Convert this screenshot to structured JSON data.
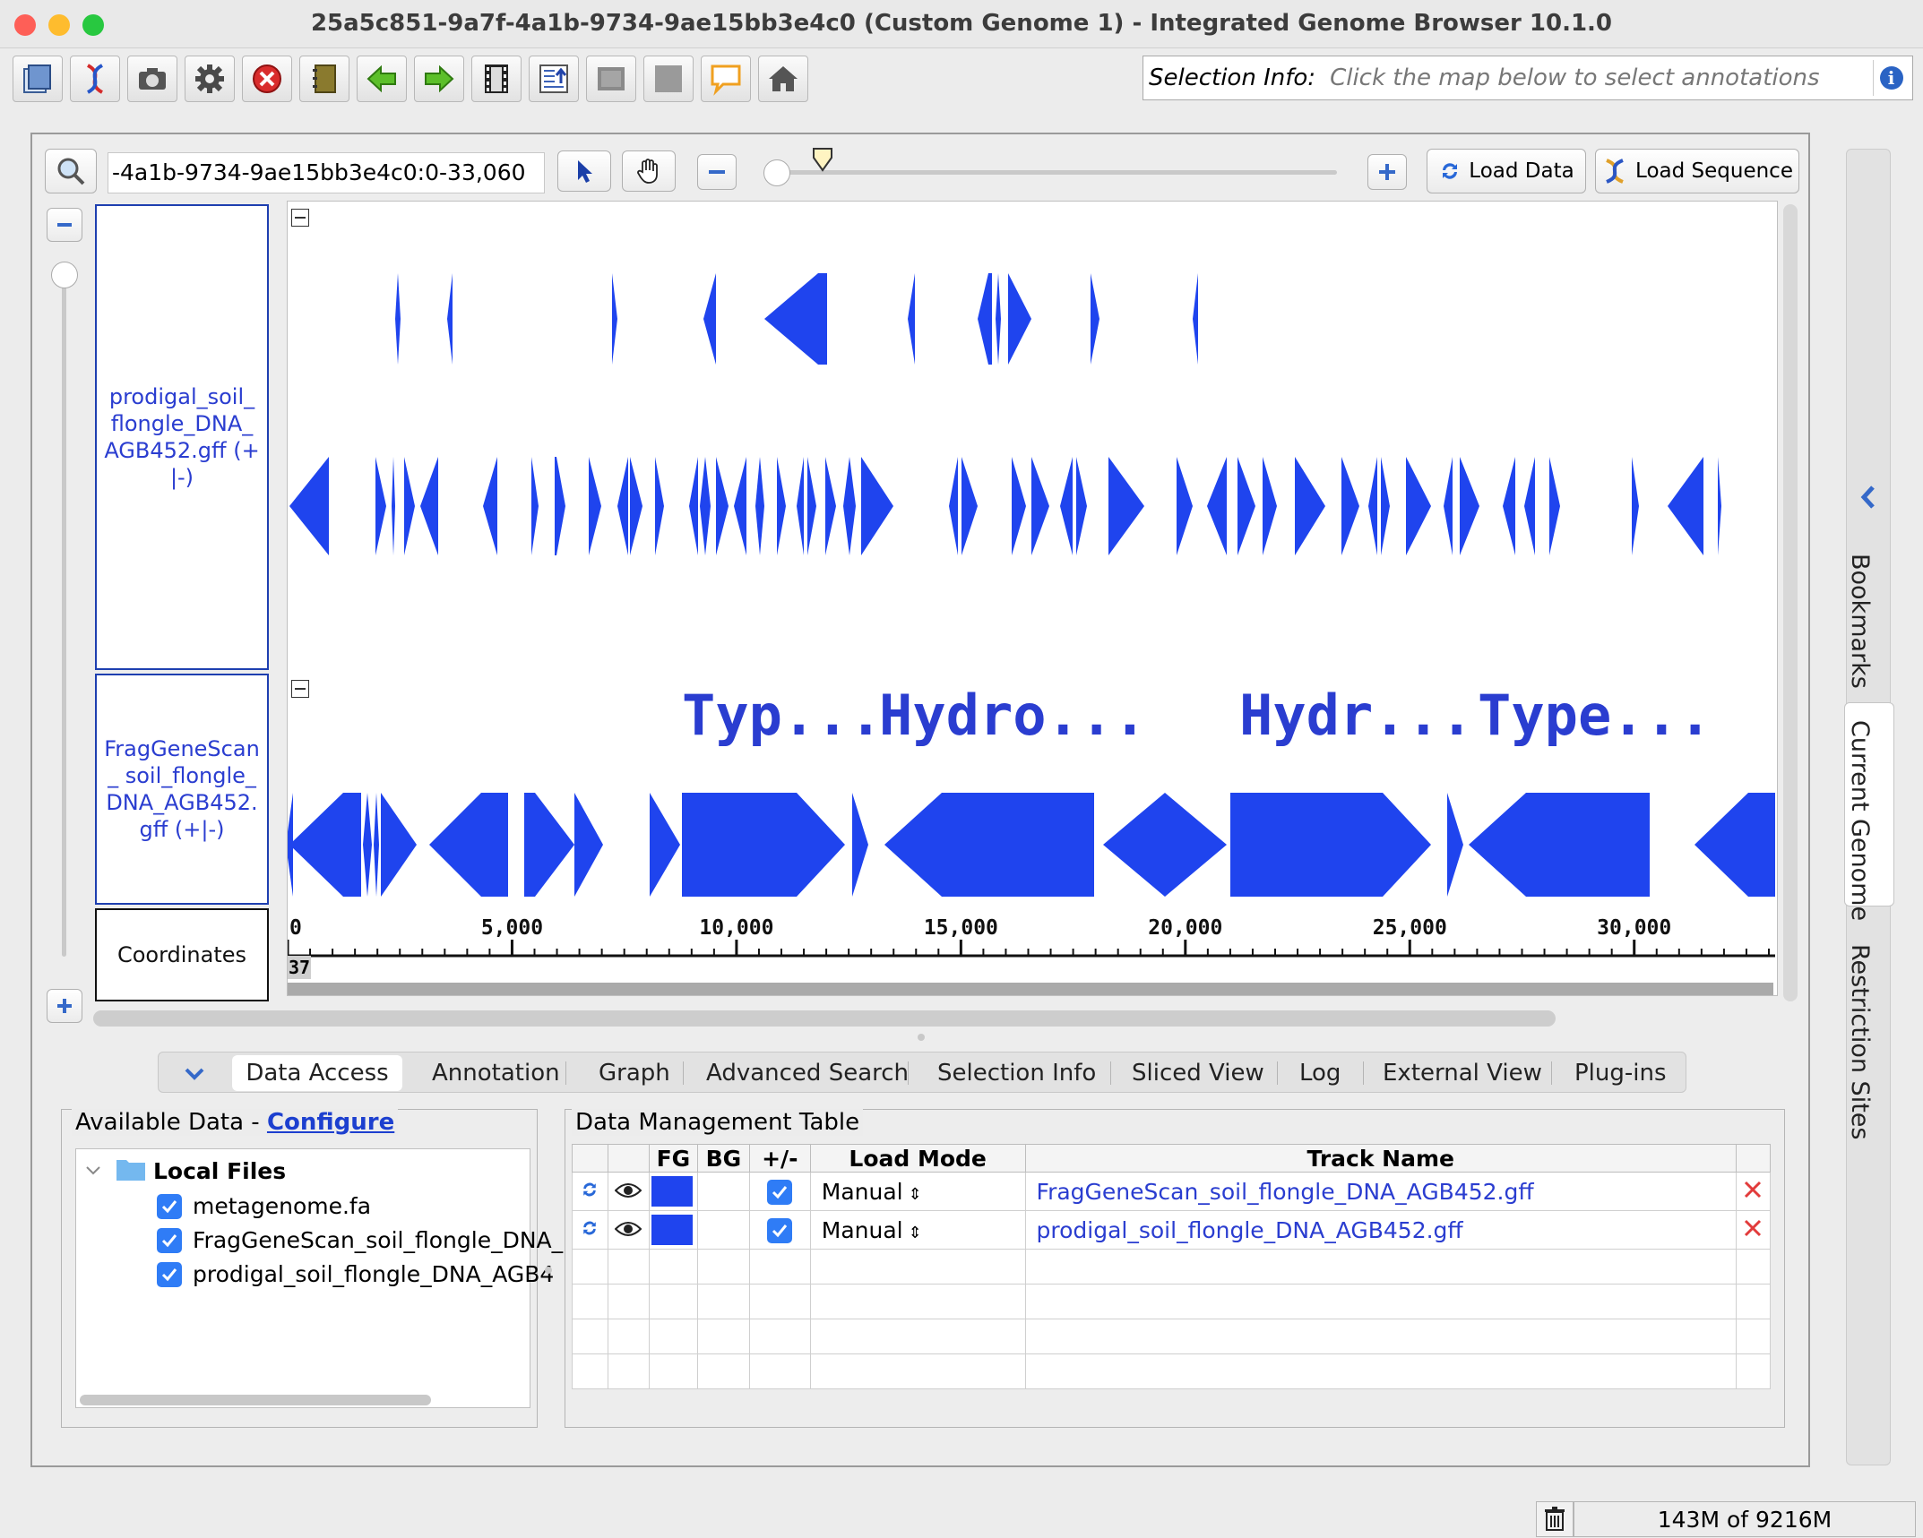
{
  "window": {
    "title": "25a5c851-9a7f-4a1b-9734-9ae15bb3e4c0  (Custom Genome 1) - Integrated Genome Browser 10.1.0"
  },
  "toolbar": {
    "buttons": [
      "open-file-icon",
      "dna-icon",
      "camera-icon",
      "gear-icon",
      "stop-icon",
      "notebook-icon",
      "back-arrow-icon",
      "forward-arrow-icon",
      "film-icon",
      "export-icon",
      "panel-icon",
      "grid-icon",
      "speech-bubble-icon",
      "home-icon"
    ],
    "selection_label": "Selection Info:",
    "selection_placeholder": "Click the map below to select annotations"
  },
  "browser": {
    "location": "-4a1b-9734-9ae15bb3e4c0:0-33,060",
    "load_data": "Load Data",
    "load_sequence": "Load Sequence",
    "tracks": [
      {
        "label": "prodigal_soil_ flongle_DNA_ AGB452.gff (+|-)"
      },
      {
        "label": "FragGeneScan_ soil_flongle_ DNA_AGB452. gff (+|-)"
      },
      {
        "label": "Coordinates"
      }
    ],
    "annotation_labels": [
      "Typ...",
      "Hydro...",
      "Hydr...",
      "Type..."
    ],
    "ruler": {
      "ticks": [
        {
          "value": 0,
          "label": "0"
        },
        {
          "value": 5000,
          "label": "5,000"
        },
        {
          "value": 10000,
          "label": "10,000"
        },
        {
          "value": 15000,
          "label": "15,000"
        },
        {
          "value": 20000,
          "label": "20,000"
        },
        {
          "value": 25000,
          "label": "25,000"
        },
        {
          "value": 30000,
          "label": "30,000"
        }
      ],
      "start_badge": "37"
    }
  },
  "colors": {
    "annotation": "#1f44ee",
    "label_text": "#2a3dd0"
  },
  "sidebar_tabs": [
    "Bookmarks",
    "Current Genome",
    "Restriction Sites"
  ],
  "bottom_tabs": [
    "Data Access",
    "Annotation",
    "Graph",
    "Advanced Search",
    "Selection Info",
    "Sliced View",
    "Log",
    "External View",
    "Plug-ins"
  ],
  "available_data": {
    "title": "Available Data - ",
    "configure": "Configure",
    "folder": "Local Files",
    "files": [
      "metagenome.fa",
      "FragGeneScan_soil_flongle_DNA_",
      "prodigal_soil_flongle_DNA_AGB4"
    ]
  },
  "data_table": {
    "title": "Data Management Table",
    "headers": [
      "",
      "",
      "FG",
      "BG",
      "+/-",
      "Load Mode",
      "Track Name",
      ""
    ],
    "rows": [
      {
        "load_mode": "Manual",
        "track_name": "FragGeneScan_soil_flongle_DNA_AGB452.gff"
      },
      {
        "load_mode": "Manual",
        "track_name": "prodigal_soil_flongle_DNA_AGB452.gff"
      }
    ]
  },
  "status": {
    "memory": "143M of 9216M"
  }
}
